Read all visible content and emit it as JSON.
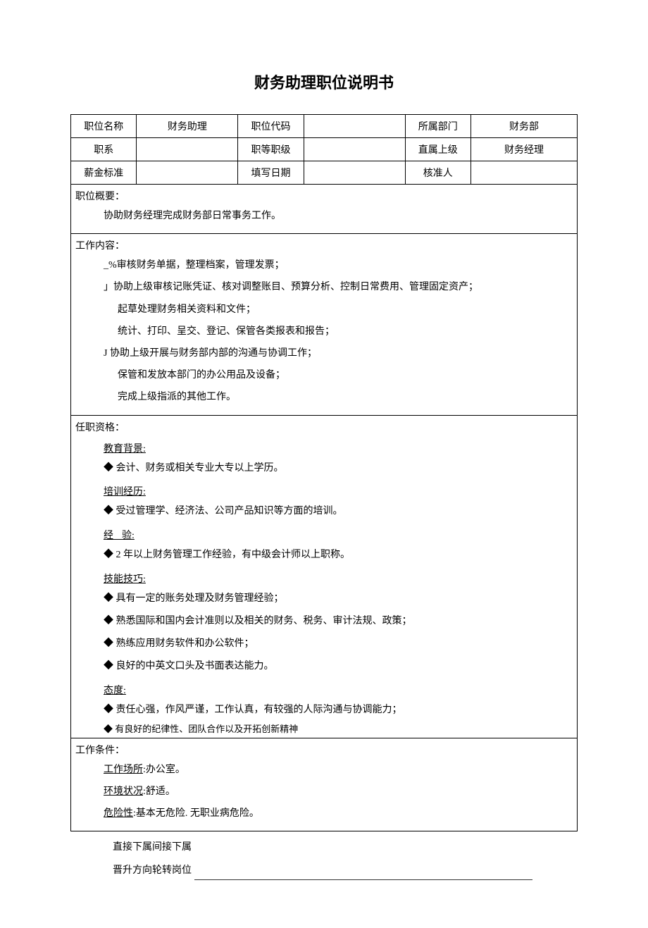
{
  "title": "财务助理职位说明书",
  "header": {
    "r1": {
      "c1": "职位名称",
      "c2": "财务助理",
      "c3": "职位代码",
      "c4": "",
      "c5": "所属部门",
      "c6": "财务部"
    },
    "r2": {
      "c1": "职系",
      "c2": "",
      "c3": "职等职级",
      "c4": "",
      "c5": "直属上级",
      "c6": "财务经理"
    },
    "r3": {
      "c1": "薪金标准",
      "c2": "",
      "c3": "填写日期",
      "c4": "",
      "c5": "核准人",
      "c6": ""
    }
  },
  "overview": {
    "heading": "职位概要：",
    "text": "协助财务经理完成财务部日常事务工作。"
  },
  "duties": {
    "heading": "工作内容：",
    "lines": [
      "_%审核财务单据，整理档案，管理发票；",
      "」协助上级审核记账凭证、核对调整账目、预算分析、控制日常费用、管理固定资产；",
      "起草处理财务相关资料和文件；",
      "统计、打印、呈交、登记、保管各类报表和报告；",
      "J 协助上级开展与财务部内部的沟通与协调工作；",
      "保管和发放本部门的办公用品及设备；",
      "完成上级指派的其他工作。"
    ]
  },
  "qualifications": {
    "heading": "任职资格：",
    "edu_head": "教育背景:",
    "edu_item": "◆ 会计、财务或相关专业大专以上学历。",
    "train_head": "培训经历:",
    "train_item": "◆ 受过管理学、经济法、公司产品知识等方面的培训。",
    "exp_head_prefix": "经",
    "exp_head_suffix": "验:",
    "exp_item": "◆ 2 年以上财务管理工作经验，有中级会计师以上职称。",
    "skill_head": "技能技巧:",
    "skill_items": [
      "◆ 具有一定的账务处理及财务管理经验；",
      "◆ 熟悉国际和国内会计准则以及相关的财务、税务、审计法规、政策；",
      "◆ 熟练应用财务软件和办公软件；",
      "◆ 良好的中英文口头及书面表达能力。"
    ],
    "attitude_head": "态度:",
    "attitude_items": [
      "◆ 责任心强，作风严谨，工作认真，有较强的人际沟通与协调能力；",
      "◆ 有良好的纪律性、团队合作以及开拓创新精神"
    ]
  },
  "conditions": {
    "heading": "工作条件：",
    "loc_label": "工作场所",
    "loc_value": ":办公室。",
    "env_label": "环境状况",
    "env_value": ":舒适。",
    "risk_label": "危险性",
    "risk_value": ":基本无危险. 无职业病危险。"
  },
  "footer": {
    "line1": "直接下属间接下属",
    "line2_prefix": "晋升方向轮转岗位"
  }
}
